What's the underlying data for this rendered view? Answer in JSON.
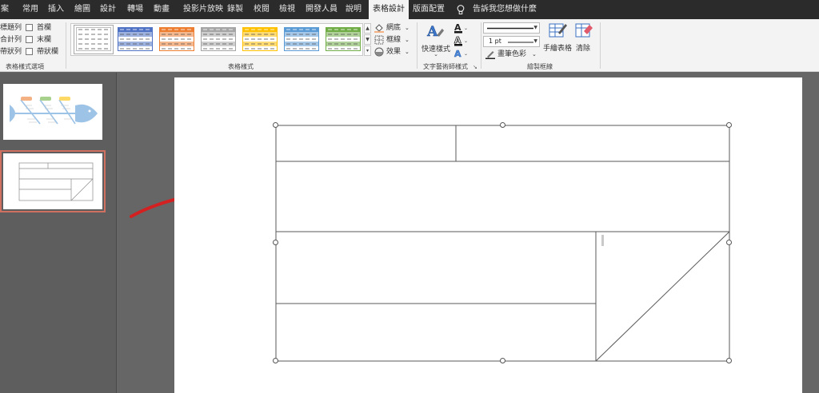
{
  "tabs": [
    "案",
    "常用",
    "插入",
    "繪圖",
    "設計",
    "轉場",
    "動畫",
    "投影片放映",
    "錄製",
    "校閱",
    "檢視",
    "開發人員",
    "說明",
    "表格設計",
    "版面配置"
  ],
  "active_tab": "表格設計",
  "tell_me": "告訴我您想做什麼",
  "groups": {
    "style_options": {
      "label": "表格樣式選項",
      "col1": [
        "標題列",
        "合計列",
        "帶狀列"
      ],
      "col2": [
        "首欄",
        "末欄",
        "帶狀欄"
      ]
    },
    "table_styles": {
      "label": "表格樣式",
      "shading": "網底",
      "borders": "框線",
      "effects": "效果",
      "gallery_colors": [
        "#ffffff",
        "#4f72c4",
        "#ed7d31",
        "#a5a5a5",
        "#ffc000",
        "#5b9bd5",
        "#70ad47"
      ]
    },
    "wordart": {
      "label": "文字藝術師樣式",
      "quick_styles": "快速樣式"
    },
    "draw_borders": {
      "label": "繪製框線",
      "pen_weight": "1 pt",
      "pen_color": "畫筆色彩",
      "draw_table": "手繪表格",
      "eraser": "清除"
    }
  },
  "colors": {
    "annotation_arrow": "#d32121",
    "tab_bar": "#2b2b2b",
    "thumbnail_selected": "#d07060"
  }
}
